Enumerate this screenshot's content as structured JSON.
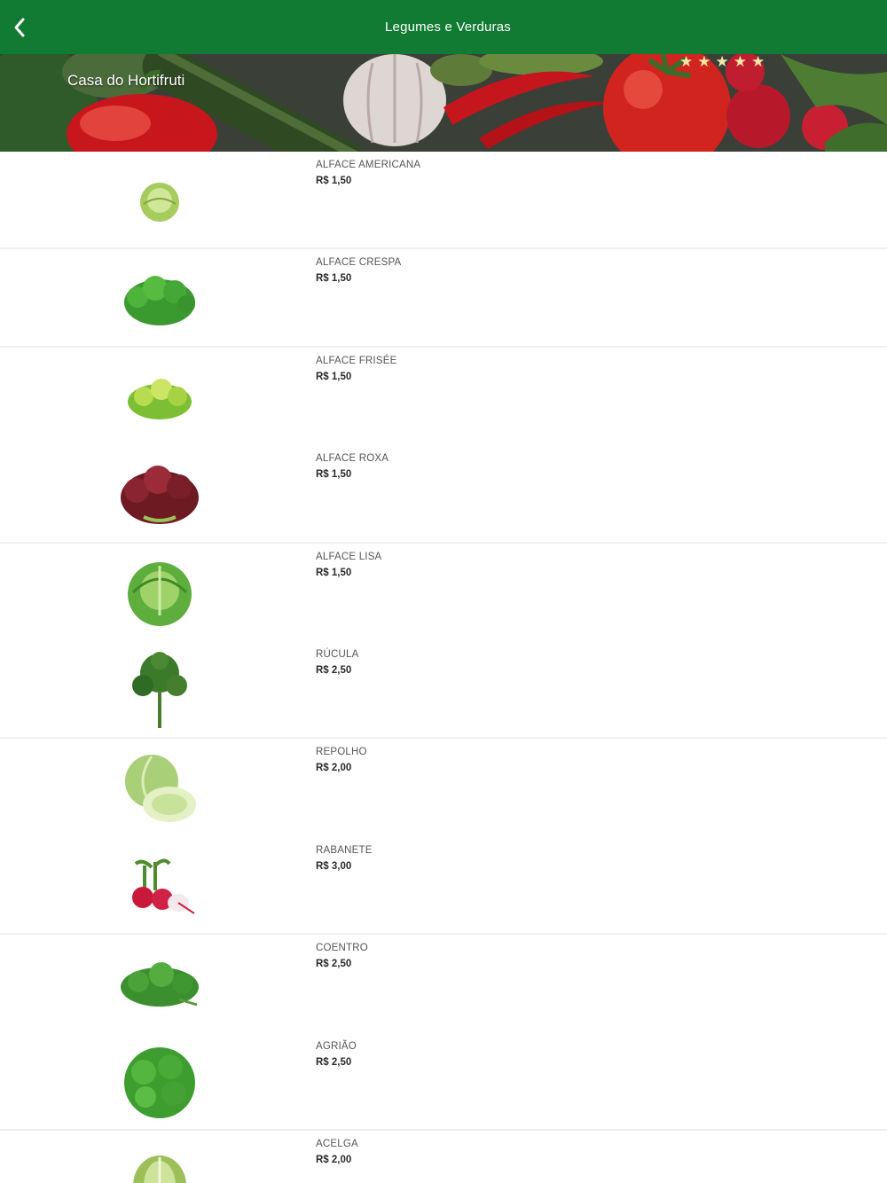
{
  "header": {
    "title": "Legumes e Verduras",
    "back_icon": "chevron-left-icon",
    "bar_color": "#127b33"
  },
  "store": {
    "name": "Casa do Hortifruti",
    "rating_stars": 5,
    "star_icon": "star-icon"
  },
  "products": [
    {
      "name": "ALFACE AMERICANA",
      "price": "R$ 1,50",
      "icon": "iceberg-lettuce-icon"
    },
    {
      "name": "ALFACE CRESPA",
      "price": "R$ 1,50",
      "icon": "curly-lettuce-icon"
    },
    {
      "name": "ALFACE FRISÉE",
      "price": "R$ 1,50",
      "icon": "frisee-lettuce-icon"
    },
    {
      "name": "ALFACE ROXA",
      "price": "R$ 1,50",
      "icon": "red-lettuce-icon"
    },
    {
      "name": "ALFACE LISA",
      "price": "R$ 1,50",
      "icon": "butter-lettuce-icon"
    },
    {
      "name": "RÚCULA",
      "price": "R$ 2,50",
      "icon": "arugula-icon"
    },
    {
      "name": "REPOLHO",
      "price": "R$ 2,00",
      "icon": "cabbage-icon"
    },
    {
      "name": "RABANETE",
      "price": "R$ 3,00",
      "icon": "radish-icon"
    },
    {
      "name": "COENTRO",
      "price": "R$ 2,50",
      "icon": "cilantro-icon"
    },
    {
      "name": "AGRIÃO",
      "price": "R$ 2,50",
      "icon": "watercress-icon"
    },
    {
      "name": "ACELGA",
      "price": "R$ 2,00",
      "icon": "chard-icon"
    }
  ]
}
